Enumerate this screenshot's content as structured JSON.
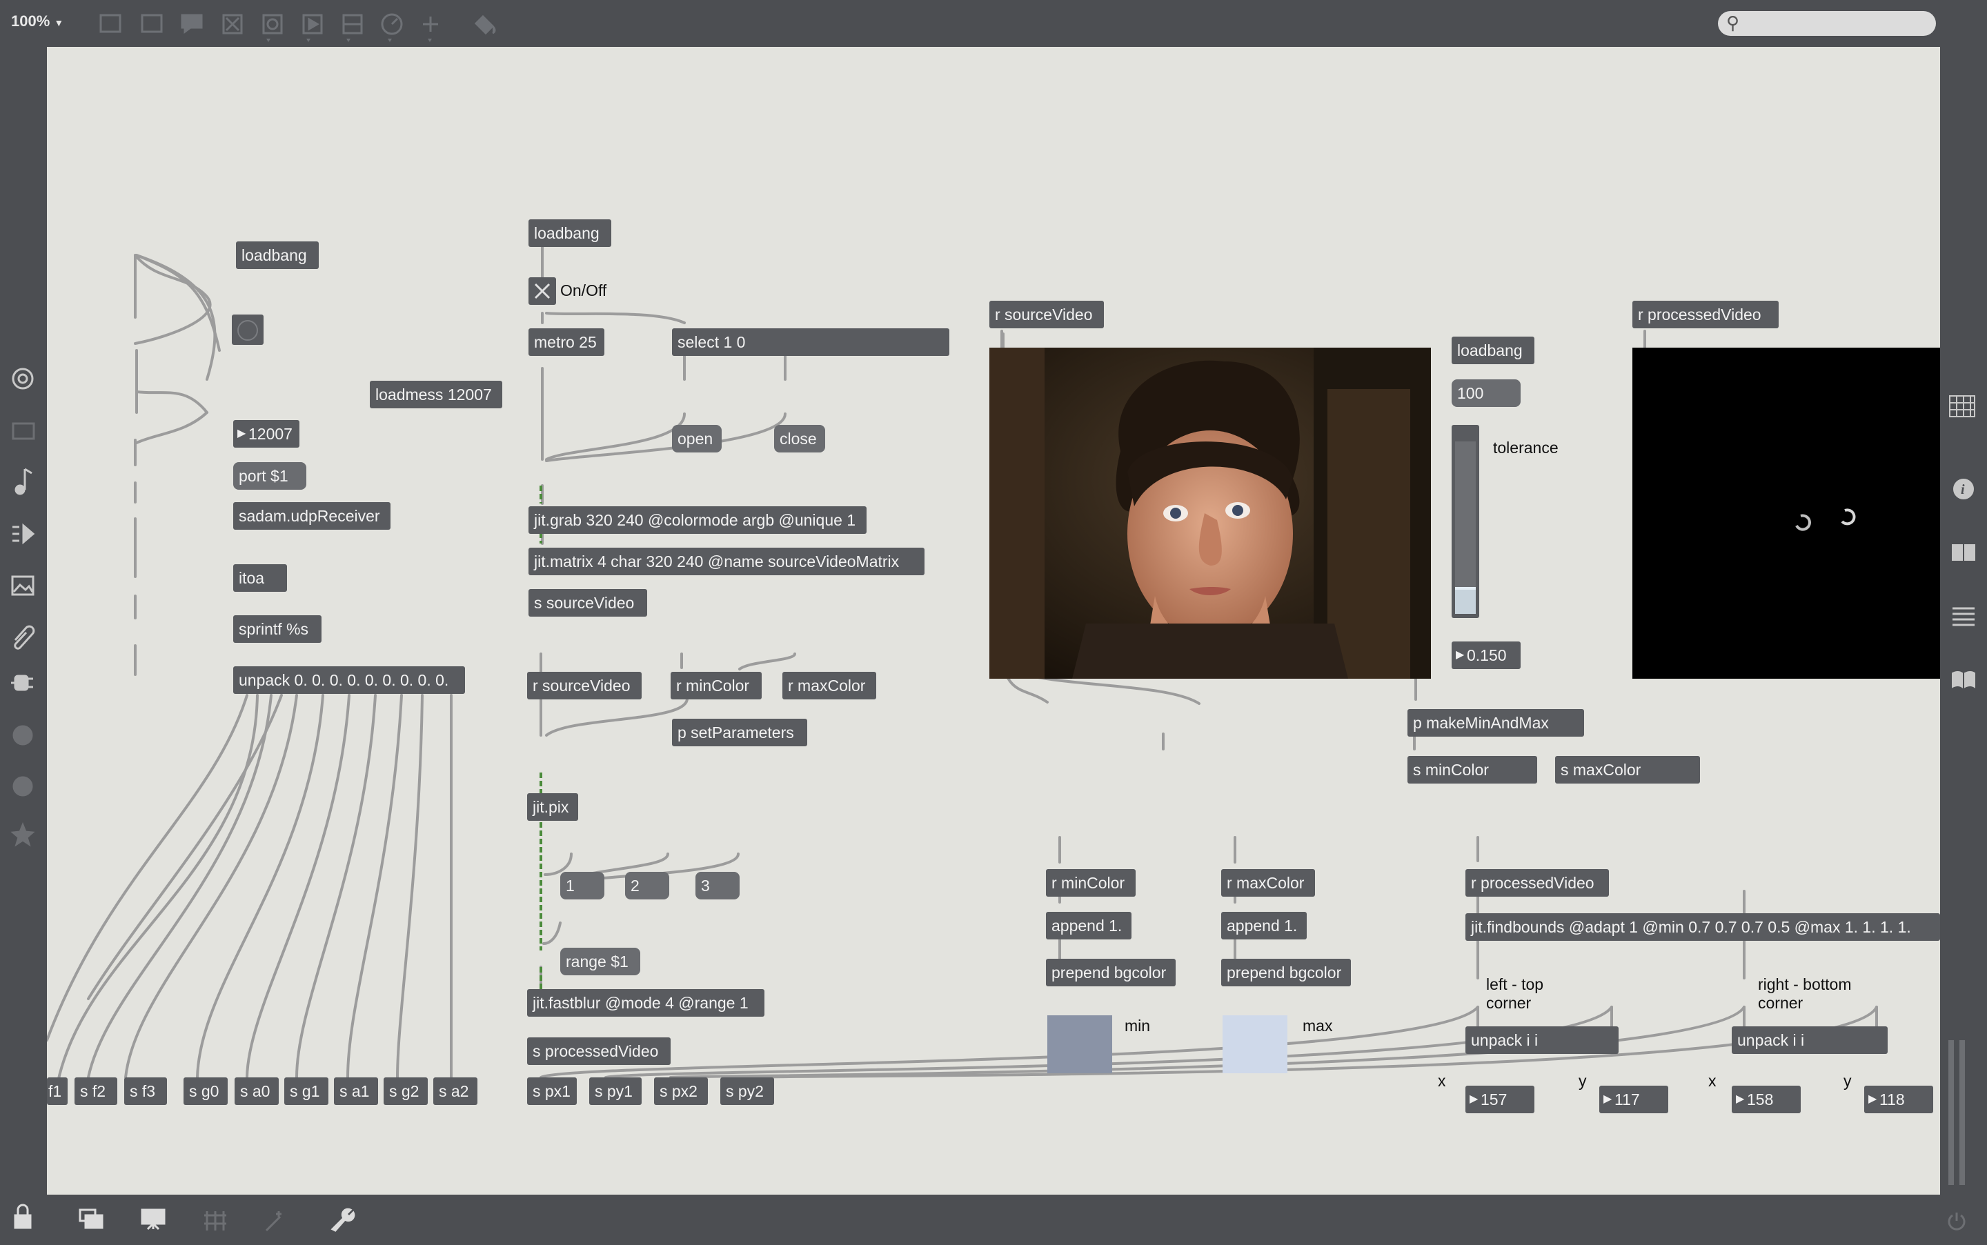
{
  "toolbar": {
    "zoom": "100%",
    "zoom_caret": "▼",
    "search_placeholder": "",
    "search_icon": "⚲"
  },
  "left_sidebar_icons": [
    "target-icon",
    "monitor-icon",
    "music-note-icon",
    "playlist-icon",
    "image-icon",
    "paperclip-icon",
    "plug-icon",
    "vimeo-icon",
    "b-icon",
    "star-icon"
  ],
  "right_sidebar_icons": [
    "grid-icon",
    "info-icon",
    "book-open-icon",
    "list-icon",
    "reference-icon"
  ],
  "bottom_icons": [
    "lock-icon",
    "windows-icon",
    "presentation-icon",
    "grid-icon",
    "magic-icon",
    "wrench-icon",
    "power-icon"
  ],
  "patch": {
    "osc": {
      "loadbang": "loadbang",
      "loadmess": "loadmess 12007",
      "number": "12007",
      "port": "port $1",
      "udp": "sadam.udpReceiver",
      "itoa": "itoa",
      "sprintf": "sprintf %s",
      "unpack": "unpack 0. 0. 0. 0. 0. 0. 0. 0. 0.",
      "sends": [
        "f1",
        "s f2",
        "s f3",
        "s g0",
        "s a0",
        "s g1",
        "s a1",
        "s g2",
        "s a2"
      ]
    },
    "grab": {
      "loadbang": "loadbang",
      "toggle_label": "On/Off",
      "metro": "metro 25",
      "select": "select 1 0",
      "open": "open",
      "close": "close",
      "jit_grab": "jit.grab 320 240 @colormode argb @unique 1",
      "jit_matrix": "jit.matrix 4 char 320 240 @name sourceVideoMatrix",
      "send": "s sourceVideo"
    },
    "process": {
      "r_source": "r sourceVideo",
      "r_min": "r minColor",
      "r_max": "r maxColor",
      "set_params": "p setParameters",
      "jit_pix": "jit.pix",
      "msg1": "1",
      "msg2": "2",
      "msg3": "3",
      "range": "range $1",
      "fastblur": "jit.fastblur @mode 4 @range 1",
      "send_processed": "s processedVideo",
      "point_sends": [
        "s px1",
        "s py1",
        "s px2",
        "s py2"
      ]
    },
    "source_view": {
      "receive": "r sourceVideo"
    },
    "tolerance": {
      "loadbang": "loadbang",
      "number": "100",
      "label": "tolerance",
      "slider_value": 0.15,
      "float": "0.150",
      "make": "p makeMinAndMax",
      "s_min": "s minColor",
      "s_max": "s maxColor"
    },
    "processed_view": {
      "receive": "r processedVideo"
    },
    "colors": {
      "r_min": "r minColor",
      "append_min": "append 1.",
      "prepend_min": "prepend bgcolor",
      "min_label": "min",
      "min_color": "#8a93a6",
      "r_max": "r maxColor",
      "append_max": "append 1.",
      "prepend_max": "prepend bgcolor",
      "max_label": "max",
      "max_color": "#cfd9ea"
    },
    "bounds": {
      "receive": "r processedVideo",
      "findbounds": "jit.findbounds @adapt 1 @min 0.7 0.7 0.7 0.5 @max 1. 1. 1. 1.",
      "left_label": "left - top\ncorner",
      "right_label": "right - bottom\ncorner",
      "unpack_left": "unpack i i",
      "unpack_right": "unpack i i",
      "x1_label": "x",
      "y1_label": "y",
      "x2_label": "x",
      "y2_label": "y",
      "x1": "157",
      "y1": "117",
      "x2": "158",
      "y2": "118"
    }
  }
}
